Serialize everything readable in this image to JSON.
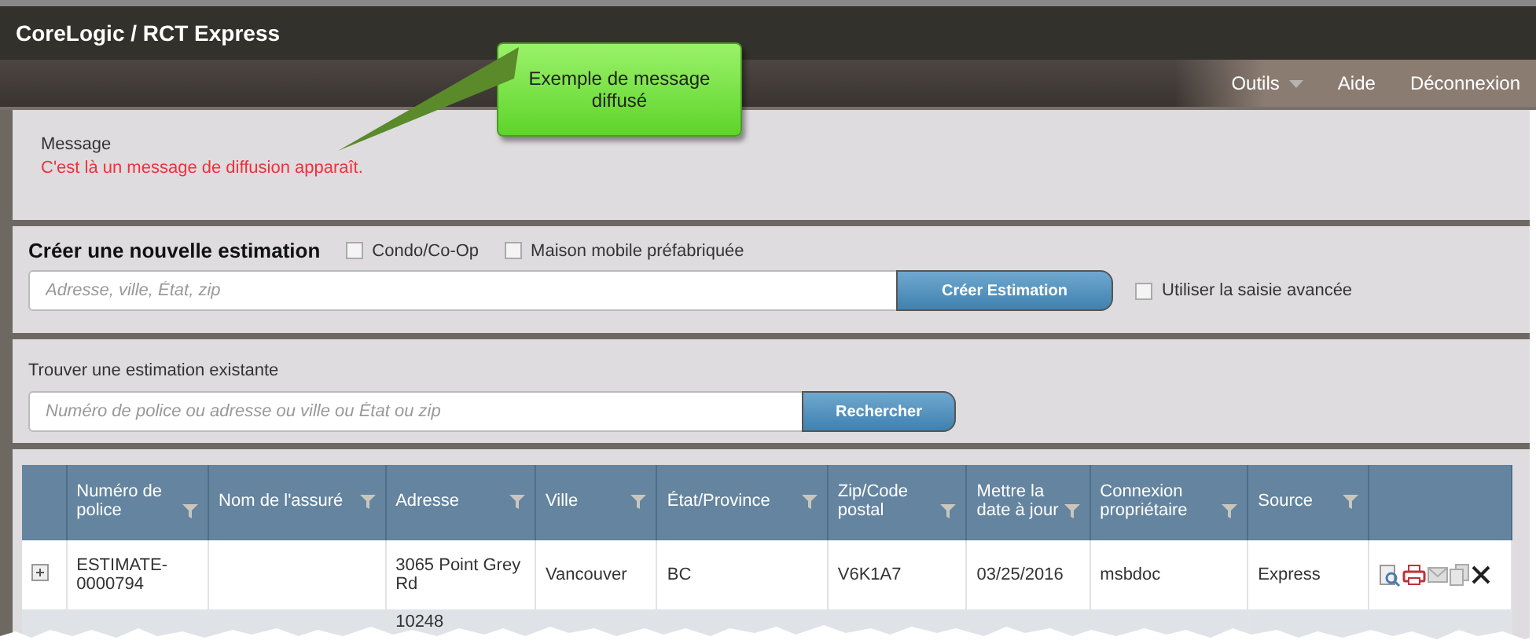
{
  "window": {
    "title": "CoreLogic / RCT Express"
  },
  "nav": [
    {
      "label": "Outils",
      "dropdown": true
    },
    {
      "label": "Aide",
      "dropdown": false
    },
    {
      "label": "Déconnexion",
      "dropdown": false
    }
  ],
  "callout": {
    "text": "Exemple de message diffusé"
  },
  "message": {
    "heading": "Message",
    "text": "C'est là un message de diffusion apparaît."
  },
  "create": {
    "title": "Créer une nouvelle estimation",
    "options": [
      {
        "label": "Condo/Co-Op",
        "checked": false
      },
      {
        "label": "Maison mobile préfabriquée",
        "checked": false
      }
    ],
    "placeholder": "Adresse, ville, État, zip",
    "button": "Créer Estimation",
    "advanced": {
      "label": "Utiliser la saisie avancée",
      "checked": false
    }
  },
  "find": {
    "title": "Trouver une estimation existante",
    "placeholder": "Numéro de police ou adresse ou ville ou État ou zip",
    "button": "Rechercher"
  },
  "table": {
    "columns": [
      {
        "label": "Numéro de police",
        "filter": true
      },
      {
        "label": "Nom de l'assuré",
        "filter": true
      },
      {
        "label": "Adresse",
        "filter": true
      },
      {
        "label": "Ville",
        "filter": true
      },
      {
        "label": "État/Province",
        "filter": true
      },
      {
        "label": "Zip/Code postal",
        "filter": true
      },
      {
        "label": "Mettre la date à jour",
        "filter": true
      },
      {
        "label": "Connexion propriétaire",
        "filter": true
      },
      {
        "label": "Source",
        "filter": true
      },
      {
        "filter": false
      }
    ],
    "rows": [
      {
        "expandable": true,
        "cells": [
          "ESTIMATE-0000794",
          null,
          "3065 Point Grey Rd",
          "Vancouver",
          "BC",
          "V6K1A7",
          "03/25/2016",
          "msbdoc",
          "Express"
        ],
        "actions": true
      },
      {
        "expandable": false,
        "cells": [
          null,
          null,
          "10248",
          null,
          null,
          null,
          null,
          null,
          null
        ],
        "actions": false
      }
    ]
  }
}
